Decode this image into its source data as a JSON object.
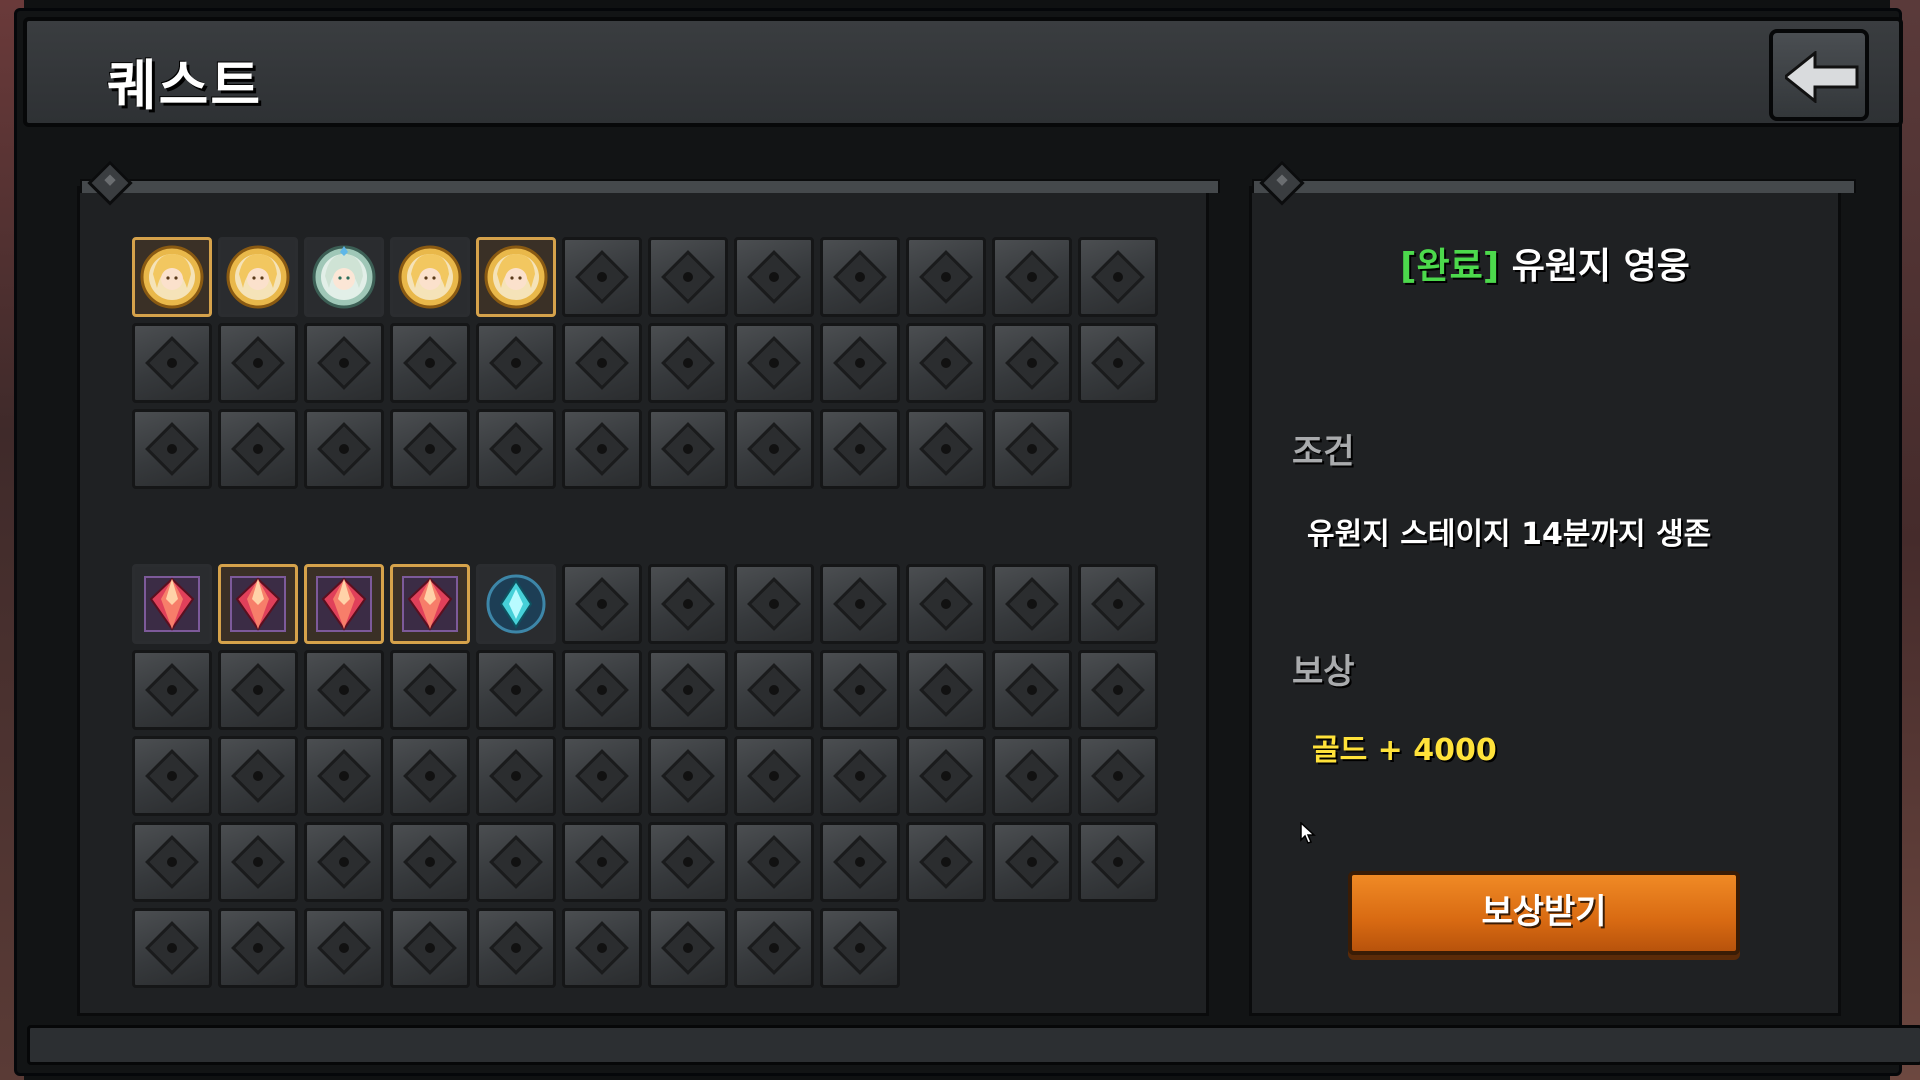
{
  "header": {
    "title": "퀘스트",
    "back_icon": "back-arrow-icon"
  },
  "quest_grid_a": {
    "slots": [
      {
        "state": "done",
        "icon": "hero-blonde-portrait-icon"
      },
      {
        "state": "plain",
        "icon": "hero-blonde-portrait-icon"
      },
      {
        "state": "plain",
        "icon": "hero-green-portrait-icon"
      },
      {
        "state": "plain",
        "icon": "hero-blonde-portrait-icon"
      },
      {
        "state": "done",
        "icon": "hero-blonde-portrait-icon"
      },
      {
        "state": "locked"
      },
      {
        "state": "locked"
      },
      {
        "state": "locked"
      },
      {
        "state": "locked"
      },
      {
        "state": "locked"
      },
      {
        "state": "locked"
      },
      {
        "state": "locked"
      },
      {
        "state": "locked"
      },
      {
        "state": "locked"
      },
      {
        "state": "locked"
      },
      {
        "state": "locked"
      },
      {
        "state": "locked"
      },
      {
        "state": "locked"
      },
      {
        "state": "locked"
      },
      {
        "state": "locked"
      },
      {
        "state": "locked"
      },
      {
        "state": "locked"
      },
      {
        "state": "locked"
      },
      {
        "state": "locked"
      },
      {
        "state": "locked"
      },
      {
        "state": "locked"
      },
      {
        "state": "locked"
      },
      {
        "state": "locked"
      },
      {
        "state": "locked"
      },
      {
        "state": "locked"
      },
      {
        "state": "locked"
      },
      {
        "state": "locked"
      },
      {
        "state": "locked"
      },
      {
        "state": "locked"
      },
      {
        "state": "locked"
      }
    ]
  },
  "quest_grid_b": {
    "slots": [
      {
        "state": "plain",
        "icon": "red-crystal-icon"
      },
      {
        "state": "done",
        "icon": "red-crystal-icon"
      },
      {
        "state": "done",
        "icon": "red-crystal-icon"
      },
      {
        "state": "done",
        "icon": "red-crystal-icon",
        "badge": "gift-badge-icon"
      },
      {
        "state": "plain",
        "icon": "teal-crystal-icon"
      },
      {
        "state": "locked"
      },
      {
        "state": "locked"
      },
      {
        "state": "locked"
      },
      {
        "state": "locked"
      },
      {
        "state": "locked"
      },
      {
        "state": "locked"
      },
      {
        "state": "locked"
      },
      {
        "state": "locked"
      },
      {
        "state": "locked"
      },
      {
        "state": "locked"
      },
      {
        "state": "locked"
      },
      {
        "state": "locked"
      },
      {
        "state": "locked"
      },
      {
        "state": "locked"
      },
      {
        "state": "locked"
      },
      {
        "state": "locked"
      },
      {
        "state": "locked"
      },
      {
        "state": "locked"
      },
      {
        "state": "locked"
      },
      {
        "state": "locked"
      },
      {
        "state": "locked"
      },
      {
        "state": "locked"
      },
      {
        "state": "locked"
      },
      {
        "state": "locked"
      },
      {
        "state": "locked"
      },
      {
        "state": "locked"
      },
      {
        "state": "locked"
      },
      {
        "state": "locked"
      },
      {
        "state": "locked"
      },
      {
        "state": "locked"
      },
      {
        "state": "locked"
      },
      {
        "state": "locked"
      },
      {
        "state": "locked"
      },
      {
        "state": "locked"
      },
      {
        "state": "locked"
      },
      {
        "state": "locked"
      },
      {
        "state": "locked"
      },
      {
        "state": "locked"
      },
      {
        "state": "locked"
      },
      {
        "state": "locked"
      },
      {
        "state": "locked"
      },
      {
        "state": "locked"
      },
      {
        "state": "locked"
      },
      {
        "state": "locked"
      },
      {
        "state": "locked"
      },
      {
        "state": "locked"
      },
      {
        "state": "locked"
      },
      {
        "state": "locked"
      },
      {
        "state": "locked"
      },
      {
        "state": "locked"
      },
      {
        "state": "locked"
      },
      {
        "state": "locked"
      }
    ]
  },
  "detail": {
    "status": "[완료]",
    "name": "유원지 영웅",
    "condition_label": "조건",
    "condition_text": "유원지 스테이지 14분까지 생존",
    "reward_label": "보상",
    "reward_text": "골드 + 4000",
    "claim_button": "보상받기"
  },
  "colors": {
    "status_green": "#4cd94c",
    "reward_yellow": "#ffe23a",
    "button_orange": "#e07414",
    "selected_border": "#d5a24b"
  }
}
